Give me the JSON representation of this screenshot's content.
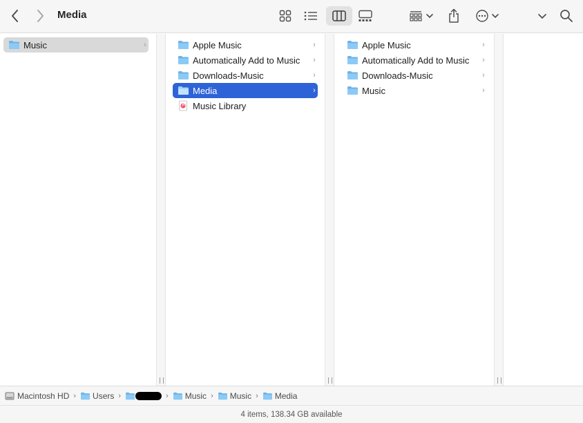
{
  "window": {
    "title": "Media"
  },
  "toolbar": {
    "back": "chevron-left-icon",
    "forward": "chevron-right-icon",
    "views": [
      "icon-view-icon",
      "list-view-icon",
      "column-view-icon",
      "gallery-view-icon"
    ],
    "active_view": "column-view-icon"
  },
  "columns": [
    {
      "items": [
        {
          "label": "Music",
          "type": "folder",
          "has_children": true,
          "selected": "inactive"
        }
      ]
    },
    {
      "items": [
        {
          "label": "Apple Music",
          "type": "folder",
          "has_children": true
        },
        {
          "label": "Automatically Add to Music",
          "type": "folder",
          "has_children": true
        },
        {
          "label": "Downloads-Music",
          "type": "folder",
          "has_children": true
        },
        {
          "label": "Media",
          "type": "folder",
          "has_children": true,
          "selected": "active"
        },
        {
          "label": "Music Library",
          "type": "music-library",
          "has_children": false
        }
      ]
    },
    {
      "items": [
        {
          "label": "Apple Music",
          "type": "folder",
          "has_children": true
        },
        {
          "label": "Automatically Add to Music",
          "type": "folder",
          "has_children": true
        },
        {
          "label": "Downloads-Music",
          "type": "folder",
          "has_children": true
        },
        {
          "label": "Music",
          "type": "folder",
          "has_children": true
        }
      ]
    },
    {
      "items": []
    }
  ],
  "pathbar": [
    {
      "label": "Macintosh HD",
      "icon": "hard-drive-icon"
    },
    {
      "label": "Users",
      "icon": "folder-icon"
    },
    {
      "label": "",
      "icon": "home-folder-icon",
      "redacted": true
    },
    {
      "label": "Music",
      "icon": "folder-icon"
    },
    {
      "label": "Music",
      "icon": "folder-icon"
    },
    {
      "label": "Media",
      "icon": "folder-icon"
    }
  ],
  "status": {
    "text": "4 items, 138.34 GB available"
  },
  "colors": {
    "selection_active": "#2e63d8",
    "selection_inactive": "#d9d9d9",
    "folder": "#6cb2ea"
  }
}
